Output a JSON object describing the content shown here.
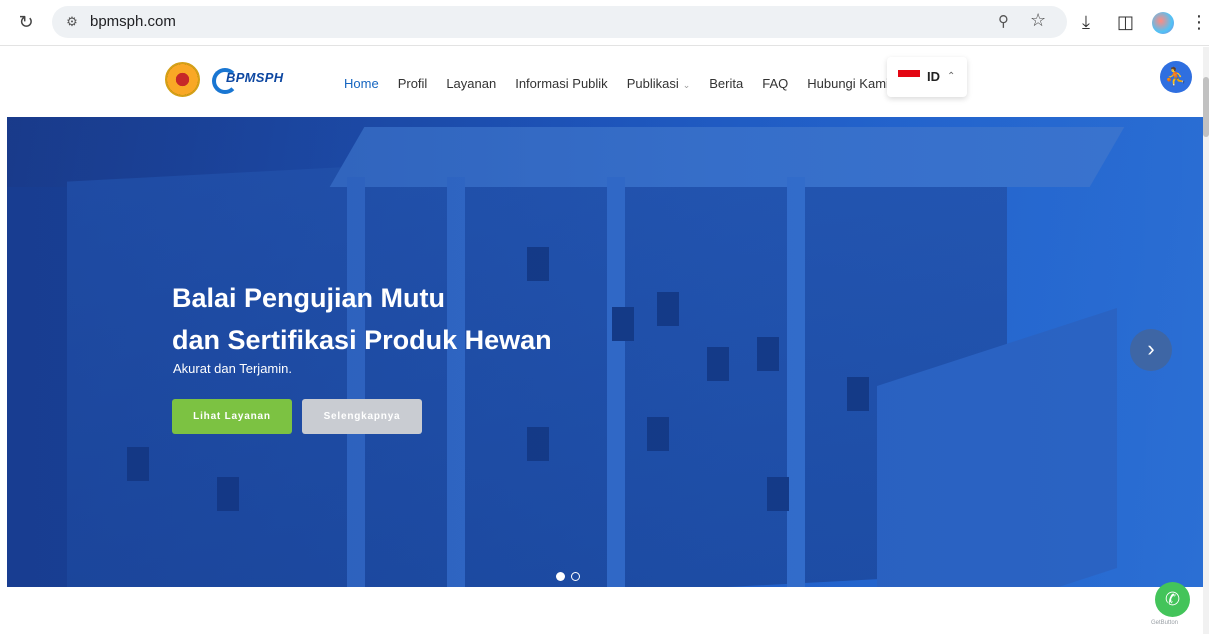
{
  "browser": {
    "url": "bpmsph.com"
  },
  "header": {
    "brand": "BPMSPH",
    "nav": [
      {
        "label": "Home"
      },
      {
        "label": "Profil"
      },
      {
        "label": "Layanan"
      },
      {
        "label": "Informasi Publik"
      },
      {
        "label": "Publikasi"
      },
      {
        "label": "Berita"
      },
      {
        "label": "FAQ"
      },
      {
        "label": "Hubungi Kami"
      }
    ],
    "language": "ID"
  },
  "hero": {
    "title_line1": "Balai Pengujian Mutu",
    "title_line2": "dan Sertifikasi Produk Hewan",
    "subtitle": "Akurat dan Terjamin.",
    "primary_button": "Lihat Layanan",
    "secondary_button": "Selengkapnya",
    "slide_count": 2,
    "active_slide": 1
  },
  "whatsapp": {
    "credit": "GetButton"
  },
  "colors": {
    "accent": "#1565c0",
    "primary_button": "#7cc242",
    "secondary_button": "#c9ccd2",
    "accessibility": "#2f6fe0",
    "whatsapp": "#43c45a"
  }
}
